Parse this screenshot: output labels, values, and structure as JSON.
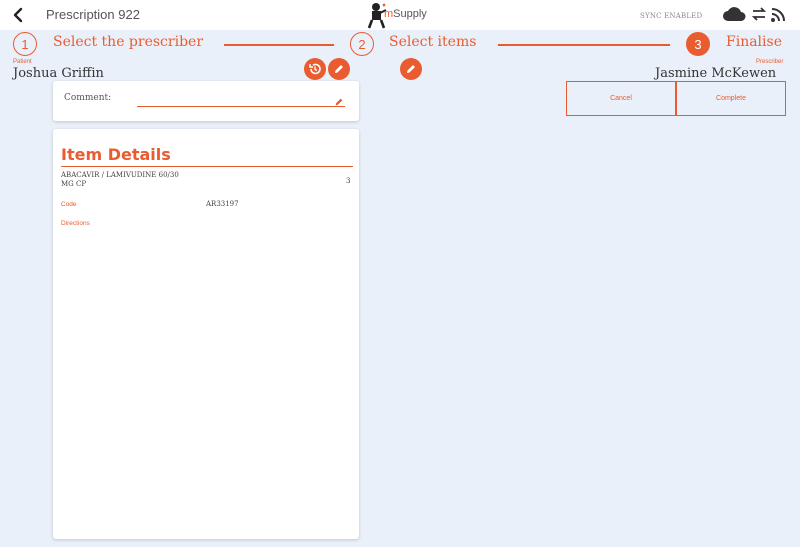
{
  "header": {
    "title": "Prescription 922",
    "logo_text_prefix": "m",
    "logo_text": "Supply",
    "sync_status": "SYNC ENABLED",
    "icons": [
      "chevron-left-icon",
      "cloud-icon",
      "sync-arrows-icon",
      "rss-icon"
    ]
  },
  "stepper": {
    "steps": [
      {
        "number": "1",
        "label": "Select the prescriber",
        "active": false
      },
      {
        "number": "2",
        "label": "Select items",
        "active": false
      },
      {
        "number": "3",
        "label": "Finalise",
        "active": true
      }
    ]
  },
  "patient": {
    "label": "Patient",
    "name": "Joshua Griffin"
  },
  "prescriber": {
    "label": "Prescriber",
    "name": "Jasmine McKewen"
  },
  "comment": {
    "label": "Comment:",
    "value": ""
  },
  "actions": {
    "cancel_label": "Cancel",
    "complete_label": "Complete"
  },
  "item_details": {
    "title": "Item Details",
    "item_name_line1": "ABACAVIR / LAMIVUDINE 60/30",
    "item_name_line2": "MG CP",
    "quantity": "3",
    "code_label": "Code",
    "code_value": "AR33197",
    "directions_label": "Directions"
  },
  "colors": {
    "accent": "#e95c30",
    "background": "#eaf0fa",
    "card": "#ffffff"
  }
}
